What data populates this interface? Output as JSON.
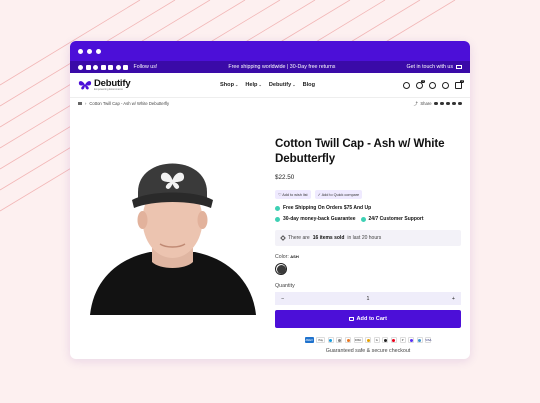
{
  "announcement": {
    "follow_label": "Follow us!",
    "center": "Free shipping worldwide | 30-Day free returns",
    "contact": "Get in touch with us"
  },
  "header": {
    "brand": "Debutify",
    "tagline": "Empowering Ecommerce",
    "nav": [
      "Shop",
      "Help",
      "Debutify",
      "Blog"
    ],
    "wishlist_count": "0",
    "cart_count": "0"
  },
  "breadcrumb": {
    "current": "Cotton Twill Cap - Ash w/ White Debutterfly",
    "share_label": "Share"
  },
  "product": {
    "title": "Cotton Twill Cap - Ash w/ White Debutterfly",
    "price": "$22.50",
    "wishlist_label": "Add to wish list",
    "compare_label": "Add to Quick compare",
    "feature_1": "Free Shipping On Orders $75 And Up",
    "feature_2": "30-day money-back Guarantee",
    "feature_3": "24/7 Customer Support",
    "sold_prefix": "There are",
    "sold_count": "16 items sold",
    "sold_suffix": "in last 20 hours",
    "color_label": "Color:",
    "color_value": "ASH",
    "quantity_label": "Quantity",
    "quantity_value": "1",
    "minus": "−",
    "plus": "+",
    "add_to_cart": "Add to Cart",
    "secure_text": "Guaranteed safe & secure checkout"
  },
  "payments": [
    {
      "name": "amex",
      "label": "AMEX",
      "color": "#1f72cd",
      "text_color": "#ffffff"
    },
    {
      "name": "applepay",
      "label": "Pay",
      "color": "#ffffff",
      "text_color": "#111111"
    },
    {
      "name": "bancontact",
      "label": "",
      "color": "#ffffff",
      "text_color": "#111111"
    },
    {
      "name": "gpay",
      "label": "",
      "color": "#ffffff",
      "text_color": "#111111"
    },
    {
      "name": "ideal",
      "label": "",
      "color": "#ffffff",
      "text_color": "#111111"
    },
    {
      "name": "discover",
      "label": "DISC",
      "color": "#ffffff",
      "text_color": "#111111"
    },
    {
      "name": "meta-pay",
      "label": "",
      "color": "#ffffff",
      "text_color": "#111111"
    },
    {
      "name": "google-pay",
      "label": "G",
      "color": "#ffffff",
      "text_color": "#111111"
    },
    {
      "name": "jcb",
      "label": "",
      "color": "#ffffff",
      "text_color": "#111111"
    },
    {
      "name": "mastercard",
      "label": "",
      "color": "#ffffff",
      "text_color": "#111111"
    },
    {
      "name": "paypal",
      "label": "P",
      "color": "#ffffff",
      "text_color": "#111111"
    },
    {
      "name": "shoppay",
      "label": "",
      "color": "#ffffff",
      "text_color": "#111111"
    },
    {
      "name": "venmo",
      "label": "",
      "color": "#ffffff",
      "text_color": "#111111"
    },
    {
      "name": "visa",
      "label": "VISA",
      "color": "#ffffff",
      "text_color": "#1a1f71"
    }
  ],
  "colors": {
    "brand_purple": "#4c0fd8",
    "announcement_bar": "#3a0aa8",
    "feature_tick": "#3ed0b4",
    "background": "#fdf0f0"
  }
}
